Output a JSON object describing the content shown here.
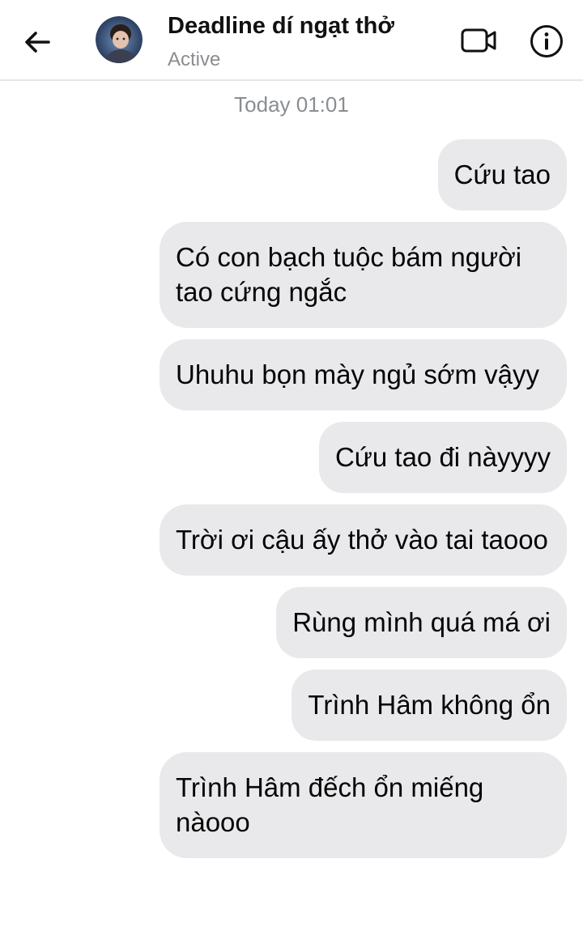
{
  "header": {
    "title": "Deadline dí ngạt thở",
    "status": "Active",
    "back_icon": "arrow-left-icon",
    "video_icon": "video-camera-icon",
    "info_icon": "info-icon"
  },
  "timestamp": "Today 01:01",
  "messages": [
    {
      "text": "Cứu tao"
    },
    {
      "text": "Có con bạch tuộc bám người tao cứng ngắc"
    },
    {
      "text": "Uhuhu bọn mày ngủ sớm vậyy"
    },
    {
      "text": "Cứu tao đi nàyyyy"
    },
    {
      "text": "Trời ơi cậu ấy thở vào tai taooo"
    },
    {
      "text": "Rùng mình quá má ơi"
    },
    {
      "text": "Trình Hâm không ổn"
    },
    {
      "text": "Trình Hâm đếch ổn miếng nàooo"
    }
  ],
  "colors": {
    "bubble": "#e9e9eb",
    "muted_text": "#8a8d91",
    "divider": "#e4e6eb"
  }
}
